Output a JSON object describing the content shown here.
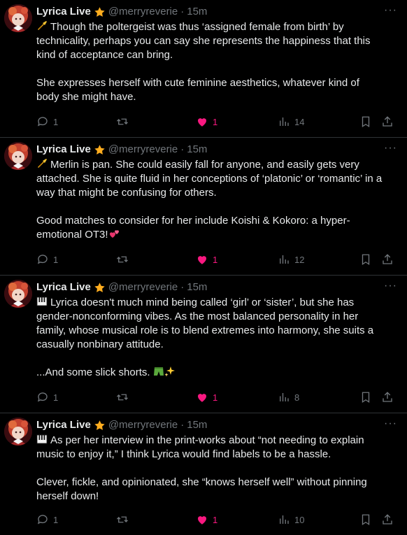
{
  "accent_like": "#f91880",
  "icons": {
    "verified": "star-badge-icon",
    "reply": "reply-bubble-icon",
    "retweet": "retweet-icon",
    "like": "heart-filled-icon",
    "views": "views-bar-icon",
    "bookmark": "bookmark-icon",
    "share": "share-icon",
    "more": "more-dots-icon",
    "trumpet": "trumpet-emoji",
    "keyboard": "piano-keys-emoji",
    "hearts": "two-hearts-emoji",
    "shorts": "shorts-emoji",
    "sparkles": "sparkles-emoji"
  },
  "more_label": "···",
  "tweets": [
    {
      "name": "Lyrica Live",
      "handle": "@merryreverie",
      "dot": "·",
      "time": "15m",
      "p1": "Though the poltergeist was thus ‘assigned female from birth’ by technicality, perhaps you can say she represents the happiness that this kind of acceptance can bring.",
      "p2": "She expresses herself with cute feminine aesthetics, whatever kind of body she might have.",
      "replies": "1",
      "likes": "1",
      "views": "14"
    },
    {
      "name": "Lyrica Live",
      "handle": "@merryreverie",
      "dot": "·",
      "time": "15m",
      "p1": "Merlin is pan.  She could easily fall for anyone, and easily gets very attached.  She is quite fluid in her conceptions of ‘platonic’ or ‘romantic’ in a way that might be confusing for others.",
      "p2": "Good matches to consider for her include Koishi & Kokoro: a hyper-emotional OT3!",
      "replies": "1",
      "likes": "1",
      "views": "12"
    },
    {
      "name": "Lyrica Live",
      "handle": "@merryreverie",
      "dot": "·",
      "time": "15m",
      "p1": "Lyrica doesn't much mind being called ‘girl’ or ‘sister’, but she has gender-nonconforming vibes.  As the most balanced personality in her family, whose musical role is to blend extremes into harmony, she suits a casually nonbinary attitude.",
      "p2": "...And some slick shorts.",
      "replies": "1",
      "likes": "1",
      "views": "8"
    },
    {
      "name": "Lyrica Live",
      "handle": "@merryreverie",
      "dot": "·",
      "time": "15m",
      "p1": "As per her interview in the print-works about “not needing to explain music to enjoy it,” I think Lyrica would find labels to be a hassle.",
      "p2": "Clever, fickle, and opinionated, she “knows herself well” without pinning herself down!",
      "replies": "1",
      "likes": "1",
      "views": "10"
    }
  ]
}
